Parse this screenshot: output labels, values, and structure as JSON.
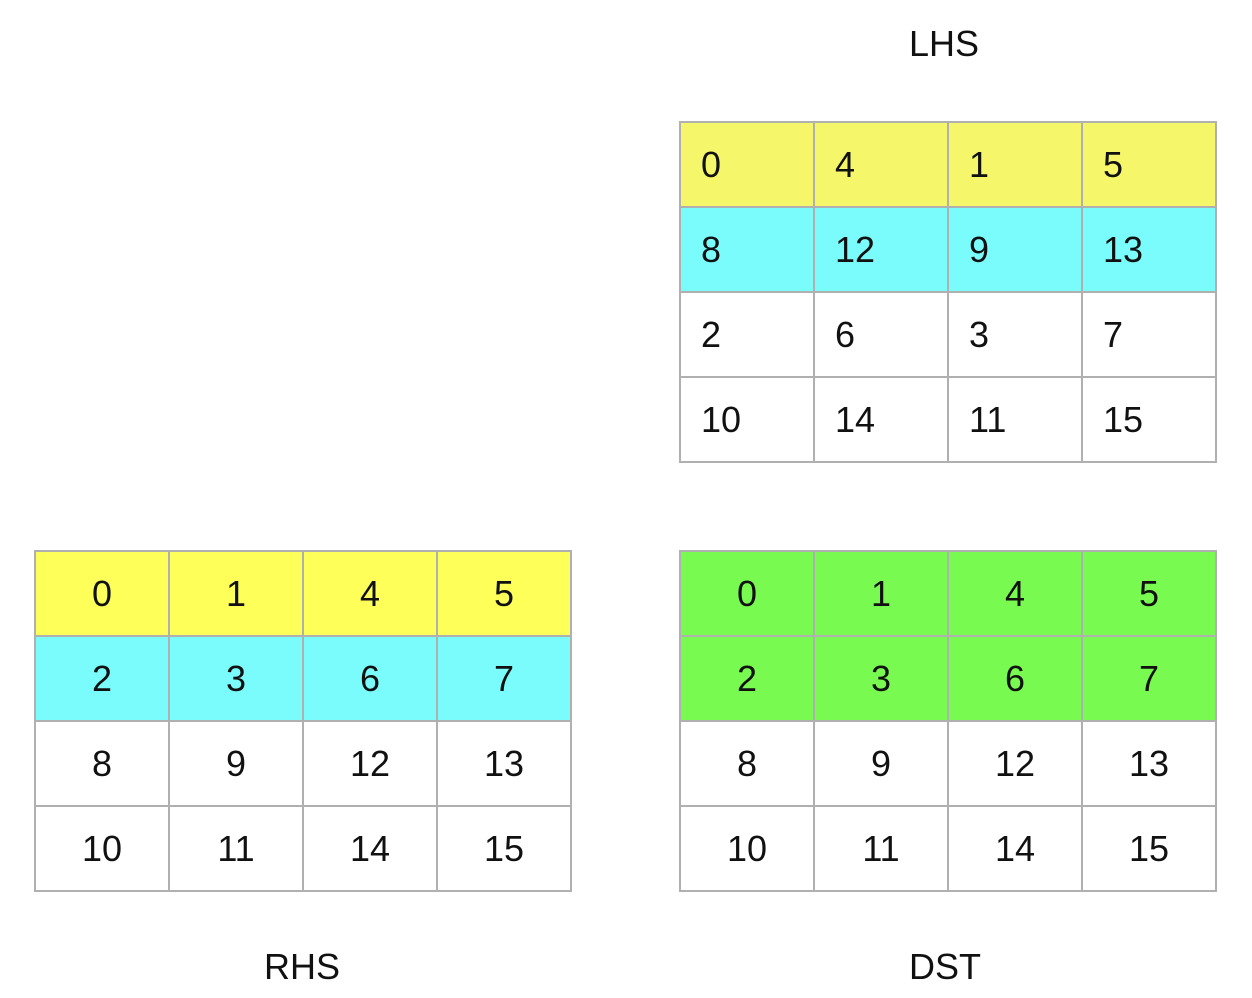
{
  "lhs": {
    "label": "LHS",
    "rows": [
      [
        "0",
        "4",
        "1",
        "5"
      ],
      [
        "8",
        "12",
        "9",
        "13"
      ],
      [
        "2",
        "6",
        "3",
        "7"
      ],
      [
        "10",
        "14",
        "11",
        "15"
      ]
    ],
    "row_colors": [
      "#f6f66a",
      "#7afcfc",
      "#ffffff",
      "#ffffff"
    ]
  },
  "rhs": {
    "label": "RHS",
    "rows": [
      [
        "0",
        "1",
        "4",
        "5"
      ],
      [
        "2",
        "3",
        "6",
        "7"
      ],
      [
        "8",
        "9",
        "12",
        "13"
      ],
      [
        "10",
        "11",
        "14",
        "15"
      ]
    ],
    "row_colors": [
      "#ffff5a",
      "#7afcfc",
      "#ffffff",
      "#ffffff"
    ]
  },
  "dst": {
    "label": "DST",
    "rows": [
      [
        "0",
        "1",
        "4",
        "5"
      ],
      [
        "2",
        "3",
        "6",
        "7"
      ],
      [
        "8",
        "9",
        "12",
        "13"
      ],
      [
        "10",
        "11",
        "14",
        "15"
      ]
    ],
    "row_colors": [
      "#78fa50",
      "#78fa50",
      "#ffffff",
      "#ffffff"
    ]
  }
}
